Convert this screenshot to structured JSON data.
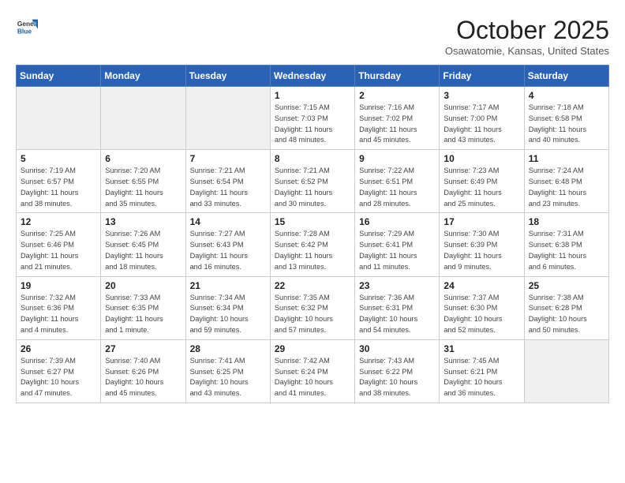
{
  "header": {
    "logo_general": "General",
    "logo_blue": "Blue",
    "month": "October 2025",
    "location": "Osawatomie, Kansas, United States"
  },
  "weekdays": [
    "Sunday",
    "Monday",
    "Tuesday",
    "Wednesday",
    "Thursday",
    "Friday",
    "Saturday"
  ],
  "weeks": [
    [
      {
        "day": "",
        "info": "",
        "empty": true
      },
      {
        "day": "",
        "info": "",
        "empty": true
      },
      {
        "day": "",
        "info": "",
        "empty": true
      },
      {
        "day": "1",
        "info": "Sunrise: 7:15 AM\nSunset: 7:03 PM\nDaylight: 11 hours\nand 48 minutes."
      },
      {
        "day": "2",
        "info": "Sunrise: 7:16 AM\nSunset: 7:02 PM\nDaylight: 11 hours\nand 45 minutes."
      },
      {
        "day": "3",
        "info": "Sunrise: 7:17 AM\nSunset: 7:00 PM\nDaylight: 11 hours\nand 43 minutes."
      },
      {
        "day": "4",
        "info": "Sunrise: 7:18 AM\nSunset: 6:58 PM\nDaylight: 11 hours\nand 40 minutes."
      }
    ],
    [
      {
        "day": "5",
        "info": "Sunrise: 7:19 AM\nSunset: 6:57 PM\nDaylight: 11 hours\nand 38 minutes."
      },
      {
        "day": "6",
        "info": "Sunrise: 7:20 AM\nSunset: 6:55 PM\nDaylight: 11 hours\nand 35 minutes."
      },
      {
        "day": "7",
        "info": "Sunrise: 7:21 AM\nSunset: 6:54 PM\nDaylight: 11 hours\nand 33 minutes."
      },
      {
        "day": "8",
        "info": "Sunrise: 7:21 AM\nSunset: 6:52 PM\nDaylight: 11 hours\nand 30 minutes."
      },
      {
        "day": "9",
        "info": "Sunrise: 7:22 AM\nSunset: 6:51 PM\nDaylight: 11 hours\nand 28 minutes."
      },
      {
        "day": "10",
        "info": "Sunrise: 7:23 AM\nSunset: 6:49 PM\nDaylight: 11 hours\nand 25 minutes."
      },
      {
        "day": "11",
        "info": "Sunrise: 7:24 AM\nSunset: 6:48 PM\nDaylight: 11 hours\nand 23 minutes."
      }
    ],
    [
      {
        "day": "12",
        "info": "Sunrise: 7:25 AM\nSunset: 6:46 PM\nDaylight: 11 hours\nand 21 minutes."
      },
      {
        "day": "13",
        "info": "Sunrise: 7:26 AM\nSunset: 6:45 PM\nDaylight: 11 hours\nand 18 minutes."
      },
      {
        "day": "14",
        "info": "Sunrise: 7:27 AM\nSunset: 6:43 PM\nDaylight: 11 hours\nand 16 minutes."
      },
      {
        "day": "15",
        "info": "Sunrise: 7:28 AM\nSunset: 6:42 PM\nDaylight: 11 hours\nand 13 minutes."
      },
      {
        "day": "16",
        "info": "Sunrise: 7:29 AM\nSunset: 6:41 PM\nDaylight: 11 hours\nand 11 minutes."
      },
      {
        "day": "17",
        "info": "Sunrise: 7:30 AM\nSunset: 6:39 PM\nDaylight: 11 hours\nand 9 minutes."
      },
      {
        "day": "18",
        "info": "Sunrise: 7:31 AM\nSunset: 6:38 PM\nDaylight: 11 hours\nand 6 minutes."
      }
    ],
    [
      {
        "day": "19",
        "info": "Sunrise: 7:32 AM\nSunset: 6:36 PM\nDaylight: 11 hours\nand 4 minutes."
      },
      {
        "day": "20",
        "info": "Sunrise: 7:33 AM\nSunset: 6:35 PM\nDaylight: 11 hours\nand 1 minute."
      },
      {
        "day": "21",
        "info": "Sunrise: 7:34 AM\nSunset: 6:34 PM\nDaylight: 10 hours\nand 59 minutes."
      },
      {
        "day": "22",
        "info": "Sunrise: 7:35 AM\nSunset: 6:32 PM\nDaylight: 10 hours\nand 57 minutes."
      },
      {
        "day": "23",
        "info": "Sunrise: 7:36 AM\nSunset: 6:31 PM\nDaylight: 10 hours\nand 54 minutes."
      },
      {
        "day": "24",
        "info": "Sunrise: 7:37 AM\nSunset: 6:30 PM\nDaylight: 10 hours\nand 52 minutes."
      },
      {
        "day": "25",
        "info": "Sunrise: 7:38 AM\nSunset: 6:28 PM\nDaylight: 10 hours\nand 50 minutes."
      }
    ],
    [
      {
        "day": "26",
        "info": "Sunrise: 7:39 AM\nSunset: 6:27 PM\nDaylight: 10 hours\nand 47 minutes."
      },
      {
        "day": "27",
        "info": "Sunrise: 7:40 AM\nSunset: 6:26 PM\nDaylight: 10 hours\nand 45 minutes."
      },
      {
        "day": "28",
        "info": "Sunrise: 7:41 AM\nSunset: 6:25 PM\nDaylight: 10 hours\nand 43 minutes."
      },
      {
        "day": "29",
        "info": "Sunrise: 7:42 AM\nSunset: 6:24 PM\nDaylight: 10 hours\nand 41 minutes."
      },
      {
        "day": "30",
        "info": "Sunrise: 7:43 AM\nSunset: 6:22 PM\nDaylight: 10 hours\nand 38 minutes."
      },
      {
        "day": "31",
        "info": "Sunrise: 7:45 AM\nSunset: 6:21 PM\nDaylight: 10 hours\nand 36 minutes."
      },
      {
        "day": "",
        "info": "",
        "empty": true
      }
    ]
  ]
}
